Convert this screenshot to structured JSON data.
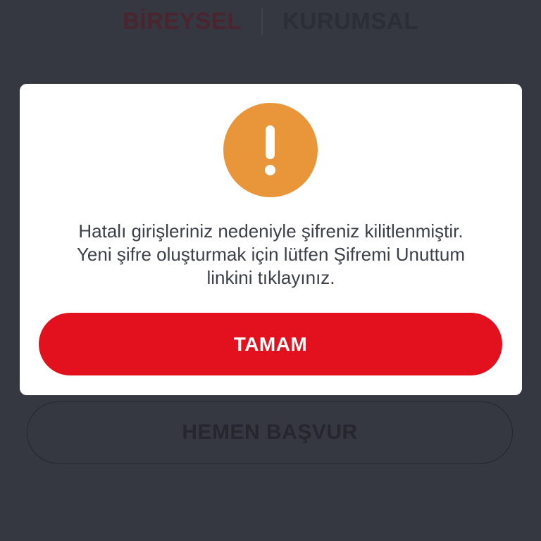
{
  "header": {
    "tabs": [
      {
        "label": "BİREYSEL",
        "active": true
      },
      {
        "label": "KURUMSAL",
        "active": false
      }
    ]
  },
  "background": {
    "apply_button_label": "HEMEN BAŞVUR"
  },
  "dialog": {
    "icon": "exclamation-icon",
    "icon_color": "#e9963a",
    "message_lines": [
      "Hatalı girişleriniz nedeniyle şifreniz kilitlenmiştir.",
      "Yeni şifre oluşturmak için lütfen Şifremi Unuttum",
      "linkini tıklayınız."
    ],
    "ok_button_label": "TAMAM",
    "ok_button_color": "#e3101e"
  }
}
